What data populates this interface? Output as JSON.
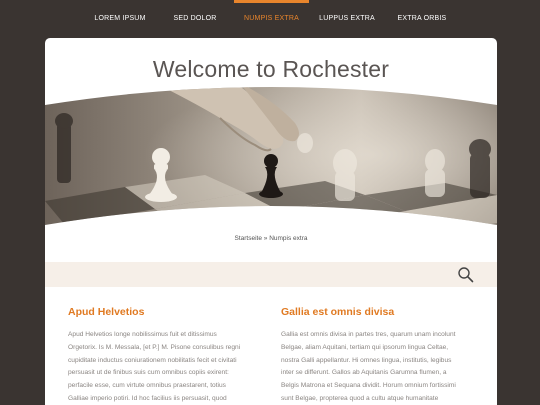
{
  "nav": {
    "items": [
      {
        "label": "LOREM IPSUM",
        "active": false
      },
      {
        "label": "SED DOLOR",
        "active": false
      },
      {
        "label": "NUMPIS EXTRA",
        "active": true
      },
      {
        "label": "LUPPUS EXTRA",
        "active": false
      },
      {
        "label": "EXTRA ORBIS",
        "active": false
      }
    ]
  },
  "page": {
    "title": "Welcome to Rochester"
  },
  "breadcrumb": {
    "home": "Startseite",
    "separator": " » ",
    "current": "Numpis extra"
  },
  "search": {
    "icon": "search-icon"
  },
  "columns": [
    {
      "heading": "Apud Helvetios",
      "lines": [
        "Apud Helvetios longe nobilissimus fuit et ditissimus",
        "Orgetorix. Is M. Messala, [et P.] M. Pisone consulibus regni",
        "cupiditate inductus coniurationem nobilitatis fecit et civitati",
        "persuasit ut de finibus suis cum omnibus copiis exirent:",
        "perfacile esse, cum virtute omnibus praestarent, totius",
        "Galliae imperio potiri. Id hoc facilius iis persuasit, quod"
      ]
    },
    {
      "heading": "Gallia est omnis divisa",
      "lines": [
        "Gallia est omnis divisa in partes tres, quarum unam incolunt",
        "Belgae, aliam Aquitani, tertiam qui ipsorum lingua Celtae,",
        "nostra Galli appellantur. Hi omnes lingua, institutis, legibus",
        "inter se differunt. Gallos ab Aquitanis Garumna flumen, a",
        "Belgis Matrona et Sequana dividit. Horum omnium fortissimi",
        "sunt Belgae, propterea quod a cultu atque humanitate"
      ]
    }
  ],
  "colors": {
    "background": "#3a3431",
    "accent": "#e8852c",
    "heading": "#e07a22",
    "searchbar": "#f6efe8"
  }
}
